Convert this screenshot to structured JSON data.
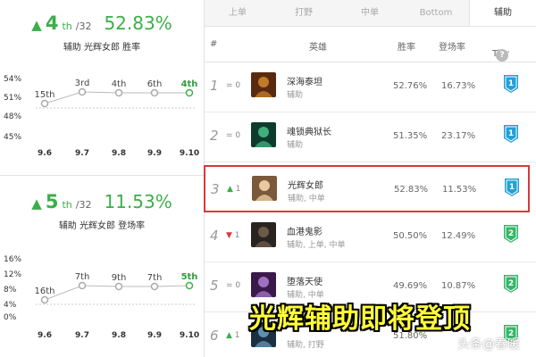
{
  "left": {
    "winrate": {
      "rank": "4",
      "rank_suffix": "th",
      "total": "/32",
      "value": "52.83%",
      "subtitle": "辅助 光辉女郎 胜率",
      "y_ticks": [
        "54%",
        "51%",
        "48%",
        "45%"
      ],
      "x_ticks": [
        "9.6",
        "9.7",
        "9.8",
        "9.9",
        "9.10"
      ],
      "point_labels": [
        "15th",
        "3rd",
        "4th",
        "6th",
        "4th"
      ]
    },
    "pickrate": {
      "rank": "5",
      "rank_suffix": "th",
      "total": "/32",
      "value": "11.53%",
      "subtitle": "辅助 光辉女郎 登场率",
      "y_ticks": [
        "16%",
        "12%",
        "8%",
        "4%",
        "0%"
      ],
      "x_ticks": [
        "9.6",
        "9.7",
        "9.8",
        "9.9",
        "9.10"
      ],
      "point_labels": [
        "16th",
        "7th",
        "9th",
        "7th",
        "5th"
      ]
    }
  },
  "tabs": [
    "上单",
    "打野",
    "中单",
    "Bottom",
    "辅助"
  ],
  "active_tab": "辅助",
  "table_header": {
    "rank": "#",
    "hero": "英雄",
    "winrate": "胜率",
    "pickrate": "登场率",
    "tier": "Tier",
    "help": "?"
  },
  "rows": [
    {
      "rank": "1",
      "change": "=0",
      "name": "深海泰坦",
      "role": "辅助",
      "winrate": "52.76%",
      "pickrate": "16.73%",
      "tier": "1"
    },
    {
      "rank": "2",
      "change": "=0",
      "name": "魂锁典狱长",
      "role": "辅助",
      "winrate": "51.35%",
      "pickrate": "23.17%",
      "tier": "1"
    },
    {
      "rank": "3",
      "change": "▲1",
      "name": "光辉女郎",
      "role": "辅助, 中单",
      "winrate": "52.83%",
      "pickrate": "11.53%",
      "tier": "1"
    },
    {
      "rank": "4",
      "change": "▼1",
      "name": "血港鬼影",
      "role": "辅助, 上单, 中单",
      "winrate": "50.50%",
      "pickrate": "12.49%",
      "tier": "2"
    },
    {
      "rank": "5",
      "change": "=0",
      "name": "堕落天使",
      "role": "辅助, 中单",
      "winrate": "49.69%",
      "pickrate": "10.87%",
      "tier": "2"
    },
    {
      "rank": "6",
      "change": "▲1",
      "name": "",
      "role": "辅助, 打野",
      "winrate": "51.80%",
      "pickrate": "",
      "tier": "2"
    }
  ],
  "colors": {
    "accent_green": "#3cae4a",
    "tier1_blue": "#23a0d6",
    "tier2_green": "#34b66a",
    "highlight_red": "#d9383a",
    "banner_yellow": "#fffc3a"
  },
  "banner": "光辉辅助即将登顶",
  "watermark": "头条@春暖"
}
